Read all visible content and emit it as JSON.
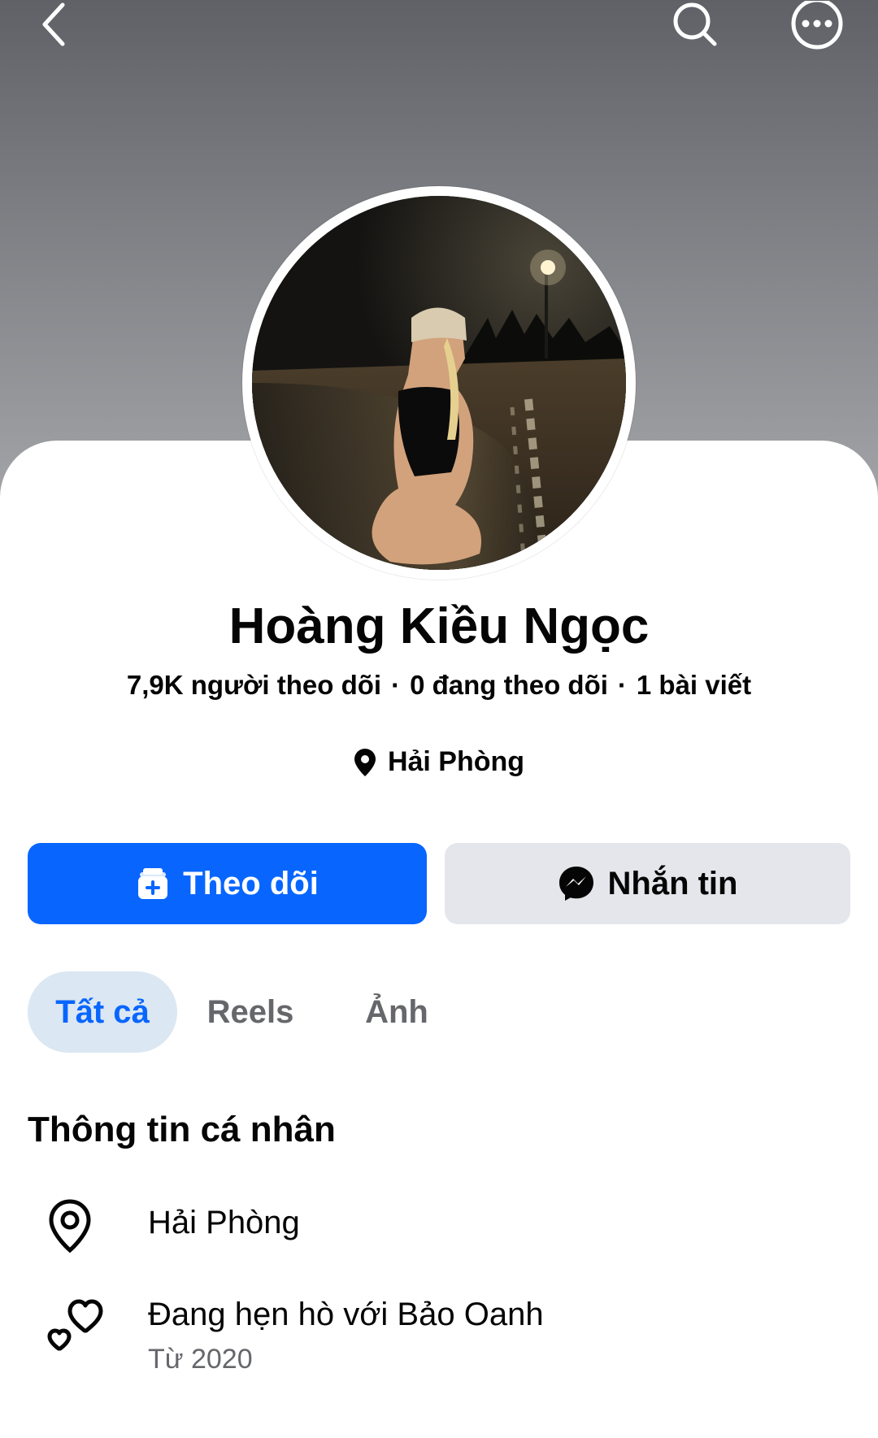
{
  "header": {
    "back_icon": "chevron-left-icon",
    "search_icon": "search-icon",
    "more_icon": "more-horizontal-icon"
  },
  "profile": {
    "name": "Hoàng Kiều Ngọc",
    "followers": "7,9K người theo dõi",
    "following": "0 đang theo dõi",
    "posts": "1 bài viết",
    "separator": "·",
    "location": "Hải Phòng"
  },
  "actions": {
    "follow_label": "Theo dõi",
    "message_label": "Nhắn tin",
    "follow_color": "#0866ff"
  },
  "tabs": [
    {
      "label": "Tất cả",
      "active": true
    },
    {
      "label": "Reels",
      "active": false
    },
    {
      "label": "Ảnh",
      "active": false
    }
  ],
  "about": {
    "title": "Thông tin cá nhân",
    "items": [
      {
        "icon": "map-pin-icon",
        "text": "Hải Phòng"
      },
      {
        "icon": "hearts-icon",
        "text": "Đang hẹn hò với Bảo Oanh",
        "sub": "Từ 2020"
      }
    ]
  }
}
